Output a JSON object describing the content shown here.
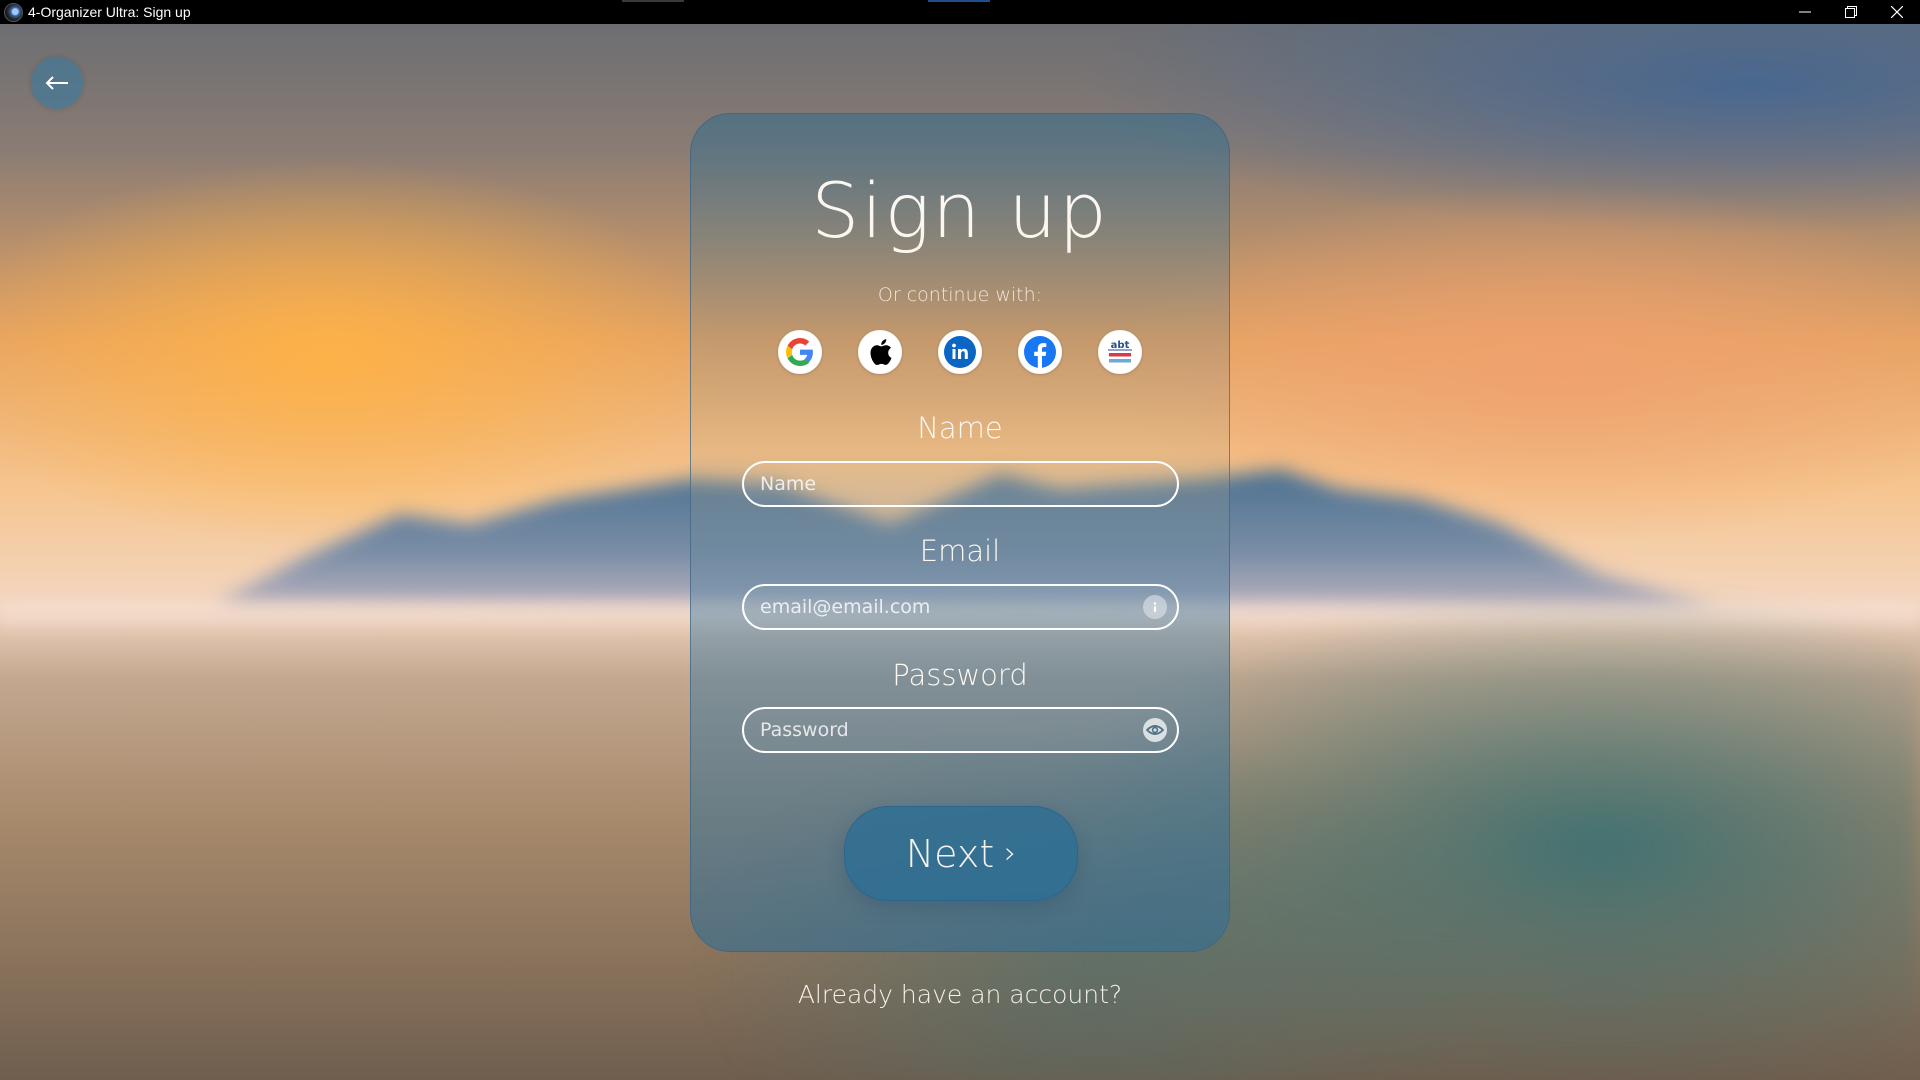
{
  "window": {
    "title": "4-Organizer Ultra: Sign up",
    "controls": [
      "minimize",
      "restore",
      "close"
    ]
  },
  "nav": {
    "back_icon": "arrow-left-icon"
  },
  "card": {
    "title": "Sign up",
    "continue_text": "Or continue with:",
    "social_providers": [
      {
        "name": "Google",
        "icon": "google-icon"
      },
      {
        "name": "Apple",
        "icon": "apple-icon"
      },
      {
        "name": "LinkedIn",
        "icon": "linkedin-icon",
        "color": "#0a66c2"
      },
      {
        "name": "Facebook",
        "icon": "facebook-icon",
        "color": "#1877f2"
      },
      {
        "name": "abt",
        "icon": "abt-icon"
      }
    ],
    "fields": {
      "name": {
        "label": "Name",
        "placeholder": "Name",
        "value": ""
      },
      "email": {
        "label": "Email",
        "placeholder": "email@email.com",
        "value": "",
        "icon": "info-icon"
      },
      "password": {
        "label": "Password",
        "placeholder": "Password",
        "value": "",
        "icon": "eye-icon"
      }
    },
    "next_label": "Next",
    "next_chevron": "›"
  },
  "footer": {
    "login_link": "Already have an account?"
  }
}
